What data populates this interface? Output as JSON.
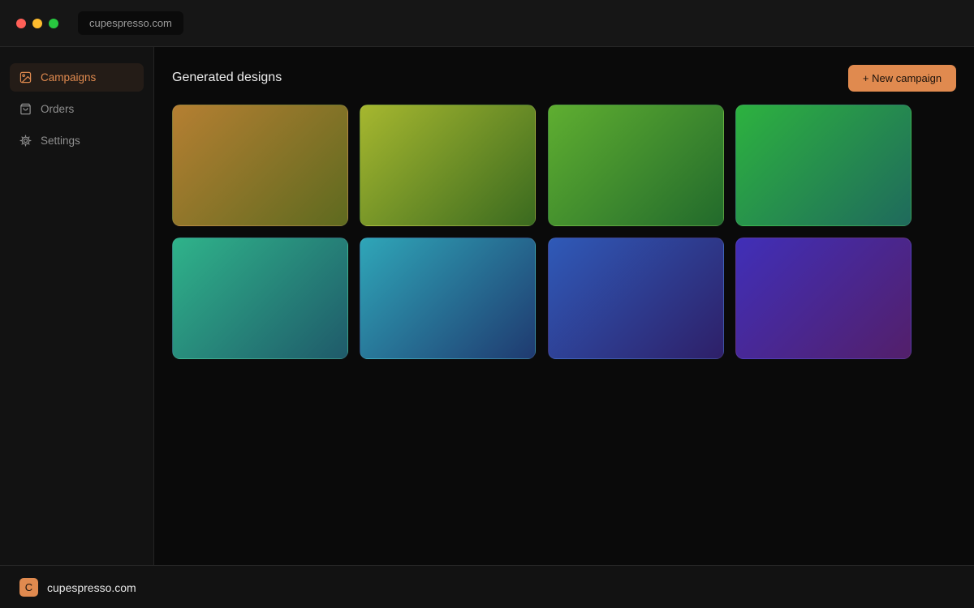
{
  "window": {
    "url": "cupespresso.com"
  },
  "sidebar": {
    "items": [
      {
        "label": "Campaigns",
        "icon": "image-icon",
        "active": true
      },
      {
        "label": "Orders",
        "icon": "shopping-bag-icon",
        "active": false
      },
      {
        "label": "Settings",
        "icon": "gear-icon",
        "active": false
      }
    ]
  },
  "main": {
    "title": "Generated designs",
    "new_button_label": "+ New campaign",
    "designs": [
      {
        "from": "#b57f32",
        "to": "#5e6a1f"
      },
      {
        "from": "#a6b72f",
        "to": "#3a6a1f"
      },
      {
        "from": "#5fae30",
        "to": "#226a2c"
      },
      {
        "from": "#2db23f",
        "to": "#1f6a5c"
      },
      {
        "from": "#2fb38a",
        "to": "#1f5a6a"
      },
      {
        "from": "#2fa6b8",
        "to": "#1f3a70"
      },
      {
        "from": "#2f5ab8",
        "to": "#2e1f68"
      },
      {
        "from": "#402fb8",
        "to": "#531f6a"
      }
    ]
  },
  "footer": {
    "logo_letter": "C",
    "site": "cupespresso.com"
  },
  "colors": {
    "accent": "#e08a4f",
    "background": "#0a0a0a",
    "sidebar": "#121212"
  }
}
